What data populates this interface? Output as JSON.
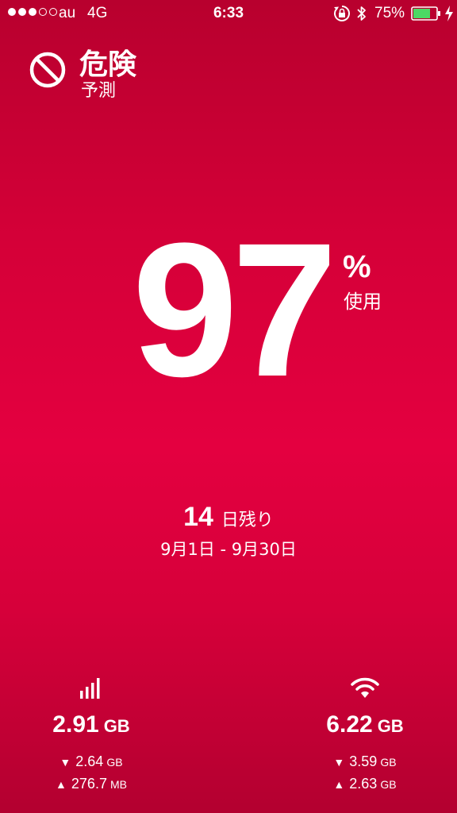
{
  "status_bar": {
    "signal_dots_filled": 3,
    "signal_dots_total": 5,
    "carrier": "au",
    "network": "4G",
    "time": "6:33",
    "battery_percent": "75%",
    "battery_level": 0.75,
    "icons": [
      "rotation-lock-icon",
      "bluetooth-icon",
      "battery-icon",
      "charging-icon"
    ]
  },
  "alert": {
    "title": "危険",
    "subtitle": "予測",
    "icon": "prohibited-icon"
  },
  "usage": {
    "percent": "97",
    "percent_sign": "%",
    "used_label": "使用"
  },
  "period": {
    "days_remaining": "14",
    "days_label": "日残り",
    "range": "9月1日 - 9月30日"
  },
  "cellular": {
    "icon": "cellular-bars-icon",
    "total_value": "2.91",
    "total_unit": "GB",
    "down_value": "2.64",
    "down_unit": "GB",
    "up_value": "276.7",
    "up_unit": "MB"
  },
  "wifi": {
    "icon": "wifi-icon",
    "total_value": "6.22",
    "total_unit": "GB",
    "down_value": "3.59",
    "down_unit": "GB",
    "up_value": "2.63",
    "up_unit": "GB"
  },
  "arrows": {
    "down": "▼",
    "up": "▲"
  },
  "colors": {
    "background_top": "#b8002e",
    "background_mid": "#e40040",
    "text": "#ffffff",
    "battery_fill": "#4cd964"
  }
}
